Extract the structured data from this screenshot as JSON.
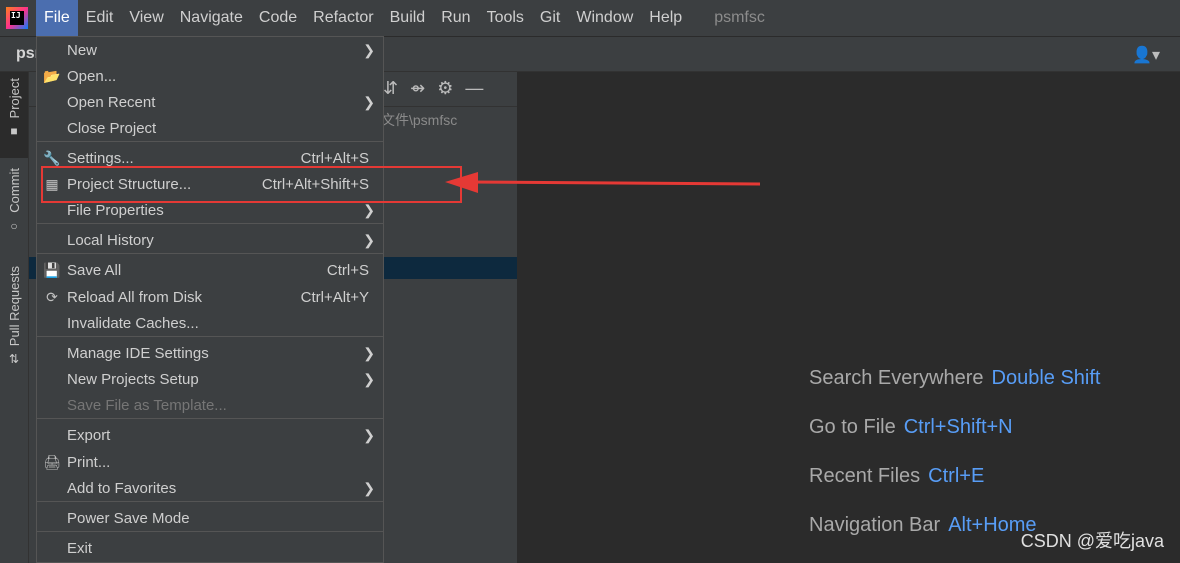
{
  "menubar": {
    "items": [
      "File",
      "Edit",
      "View",
      "Navigate",
      "Code",
      "Refactor",
      "Build",
      "Run",
      "Tools",
      "Git",
      "Window",
      "Help"
    ],
    "project_name": "psmfsc"
  },
  "toolbar": {
    "crumb": "psı"
  },
  "left_stripe": {
    "tabs": [
      "Project",
      "Commit",
      "Pull Requests"
    ]
  },
  "project_panel": {
    "path_fragment": "文件\\psmfsc"
  },
  "file_menu": {
    "items": [
      {
        "label": "New",
        "shortcut": "",
        "has_submenu": true,
        "icon": "",
        "disabled": false
      },
      {
        "label": "Open...",
        "shortcut": "",
        "has_submenu": false,
        "icon": "folder-open-icon",
        "disabled": false
      },
      {
        "label": "Open Recent",
        "shortcut": "",
        "has_submenu": true,
        "icon": "",
        "disabled": false
      },
      {
        "label": "Close Project",
        "shortcut": "",
        "has_submenu": false,
        "icon": "",
        "disabled": false
      },
      {
        "label": "Settings...",
        "shortcut": "Ctrl+Alt+S",
        "has_submenu": false,
        "icon": "wrench-icon",
        "disabled": false
      },
      {
        "label": "Project Structure...",
        "shortcut": "Ctrl+Alt+Shift+S",
        "has_submenu": false,
        "icon": "project-structure-icon",
        "disabled": false
      },
      {
        "label": "File Properties",
        "shortcut": "",
        "has_submenu": true,
        "icon": "",
        "disabled": false
      },
      {
        "label": "Local History",
        "shortcut": "",
        "has_submenu": true,
        "icon": "",
        "disabled": false
      },
      {
        "label": "Save All",
        "shortcut": "Ctrl+S",
        "has_submenu": false,
        "icon": "save-icon",
        "disabled": false
      },
      {
        "label": "Reload All from Disk",
        "shortcut": "Ctrl+Alt+Y",
        "has_submenu": false,
        "icon": "reload-icon",
        "disabled": false
      },
      {
        "label": "Invalidate Caches...",
        "shortcut": "",
        "has_submenu": false,
        "icon": "",
        "disabled": false
      },
      {
        "label": "Manage IDE Settings",
        "shortcut": "",
        "has_submenu": true,
        "icon": "",
        "disabled": false
      },
      {
        "label": "New Projects Setup",
        "shortcut": "",
        "has_submenu": true,
        "icon": "",
        "disabled": false
      },
      {
        "label": "Save File as Template...",
        "shortcut": "",
        "has_submenu": false,
        "icon": "",
        "disabled": true
      },
      {
        "label": "Export",
        "shortcut": "",
        "has_submenu": true,
        "icon": "",
        "disabled": false
      },
      {
        "label": "Print...",
        "shortcut": "",
        "has_submenu": false,
        "icon": "print-icon",
        "disabled": false
      },
      {
        "label": "Add to Favorites",
        "shortcut": "",
        "has_submenu": true,
        "icon": "",
        "disabled": false
      },
      {
        "label": "Power Save Mode",
        "shortcut": "",
        "has_submenu": false,
        "icon": "",
        "disabled": false
      },
      {
        "label": "Exit",
        "shortcut": "",
        "has_submenu": false,
        "icon": "",
        "disabled": false
      }
    ]
  },
  "editor_hints": [
    {
      "text": "Search Everywhere",
      "key": "Double Shift"
    },
    {
      "text": "Go to File",
      "key": "Ctrl+Shift+N"
    },
    {
      "text": "Recent Files",
      "key": "Ctrl+E"
    },
    {
      "text": "Navigation Bar",
      "key": "Alt+Home"
    }
  ],
  "watermark": "CSDN @爱吃java",
  "colors": {
    "accent": "#4b6eaf",
    "shortcut_key": "#589df6",
    "annotation": "#e53935"
  }
}
